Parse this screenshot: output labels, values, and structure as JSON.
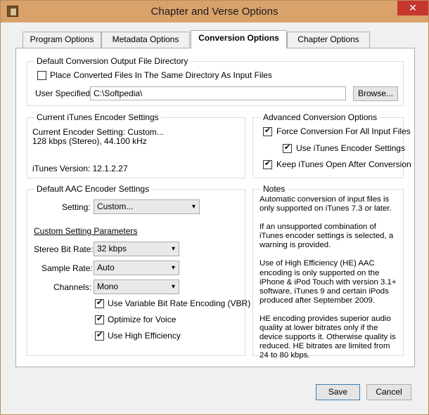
{
  "window": {
    "title": "Chapter and Verse Options",
    "close_glyph": "✕"
  },
  "tabs": [
    "Program Options",
    "Metadata Options",
    "Conversion Options",
    "Chapter Options"
  ],
  "output_dir": {
    "title": "Default Conversion Output File Directory",
    "same_dir_label": "Place Converted Files In The Same Directory As Input Files",
    "same_dir_checked": false,
    "user_specified_label": "User Specified:",
    "user_specified_value": "C:\\Softpedia\\",
    "browse_label": "Browse..."
  },
  "itunes_encoder": {
    "title": "Current iTunes Encoder Settings",
    "current_setting": "Current Encoder Setting:  Custom...",
    "details": "128 kbps (Stereo), 44.100 kHz",
    "version": "iTunes Version:  12.1.2.27"
  },
  "advanced": {
    "title": "Advanced Conversion Options",
    "force_label": "Force Conversion For All Input Files",
    "force_checked": true,
    "use_itunes_label": "Use iTunes Encoder Settings",
    "use_itunes_checked": true,
    "keep_open_label": "Keep iTunes Open After Conversion",
    "keep_open_checked": true
  },
  "aac": {
    "title": "Default AAC Encoder Settings",
    "setting_label": "Setting:",
    "setting_value": "Custom...",
    "params_label": "Custom Setting Parameters",
    "bitrate_label": "Stereo Bit Rate:",
    "bitrate_value": "32 kbps",
    "samplerate_label": "Sample Rate:",
    "samplerate_value": "Auto",
    "channels_label": "Channels:",
    "channels_value": "Mono",
    "vbr_label": "Use Variable Bit Rate Encoding (VBR)",
    "vbr_checked": true,
    "voice_label": "Optimize for Voice",
    "voice_checked": true,
    "he_label": "Use High Efficiency",
    "he_checked": true,
    "chevron": "▾"
  },
  "notes": {
    "title": "Notes",
    "p1": "Automatic conversion of input files is only supported on iTunes 7.3 or later.",
    "p2": "If an unsupported combination of iTunes encoder settings is selected, a warning is provided.",
    "p3": "Use of High Efficiency (HE) AAC encoding is only supported on the iPhone & iPod Touch with version 3.1+ software, iTunes 9 and certain iPods produced after September 2009.",
    "p4": "HE encoding provides superior audio quality at lower bitrates only if the device supports it.  Otherwise quality is reduced. HE bitrates are limited from 24 to 80 kbps."
  },
  "footer": {
    "save_label": "Save",
    "cancel_label": "Cancel"
  }
}
